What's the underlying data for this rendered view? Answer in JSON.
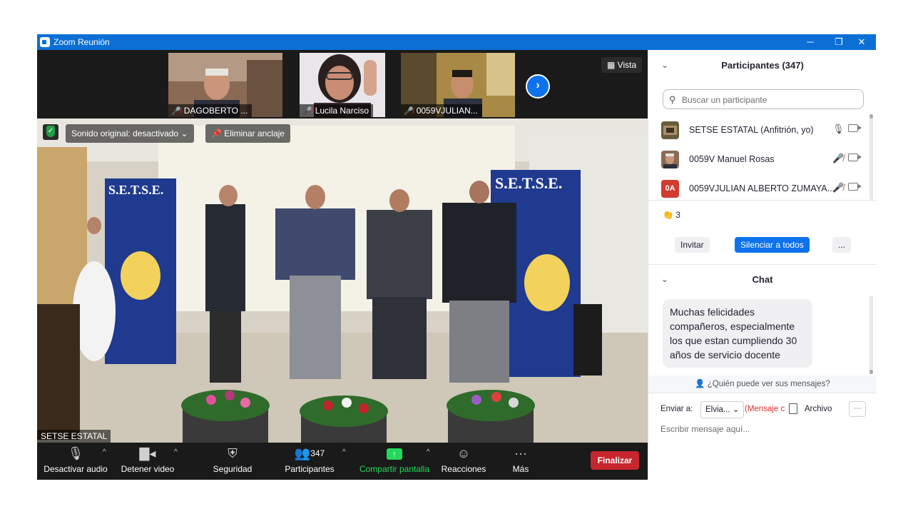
{
  "window": {
    "title": "Zoom Reunión",
    "btn_min": "─",
    "btn_restore": "❐",
    "btn_close": "✕"
  },
  "strip": {
    "thumbs": [
      {
        "name": "DAGOBERTO ..."
      },
      {
        "name": "Lucila Narciso"
      },
      {
        "name": "0059VJULIAN..."
      }
    ],
    "next": "›",
    "vista": "Vista",
    "vista_icon": "grid-icon"
  },
  "video": {
    "audio_pill": "Sonido original: desactivado",
    "audio_caret": "⌄",
    "unpin_pill": "Eliminar anclaje",
    "speaker_label": "SETSE ESTATAL",
    "banner_text": "S.E.T.S.E."
  },
  "toolbar": {
    "mute": "Desactivar audio",
    "video": "Detener video",
    "security": "Seguridad",
    "participants": "Participantes",
    "participants_count": "347",
    "share": "Compartir pantalla",
    "reactions": "Reacciones",
    "more": "Más",
    "end": "Finalizar",
    "caret": "^"
  },
  "panel": {
    "title": "Participantes (347)",
    "search_placeholder": "Buscar un participante",
    "participants": [
      {
        "name": "SETSE ESTATAL (Anfitrión, yo)",
        "mic": "on"
      },
      {
        "name": "0059V Manuel Rosas",
        "mic": "off"
      },
      {
        "name": "0059VJULIAN ALBERTO ZUMAYA...",
        "mic": "off",
        "initials": "0A"
      }
    ],
    "reaction_emoji": "👏",
    "reaction_count": "3",
    "invite": "Invitar",
    "mute_all": "Silenciar a todos",
    "more": "...",
    "chat_title": "Chat",
    "chat_message": "Muchas felicidades compañeros, especialmente los que estan cumpliendo 30 años de servicio docente",
    "who_can_see": "¿Quién puede ver sus mensajes?",
    "send_to_label": "Enviar a:",
    "send_to_value": "Elvia...",
    "message_type": "(Mensaje c",
    "file": "Archivo",
    "compose_placeholder": "Escribir mensaje aquí...",
    "dots": "···"
  },
  "colors": {
    "zoom_blue": "#0b6fd6",
    "accent_blue": "#0e72ed",
    "end_red": "#c6262d",
    "share_green": "#23d959"
  }
}
